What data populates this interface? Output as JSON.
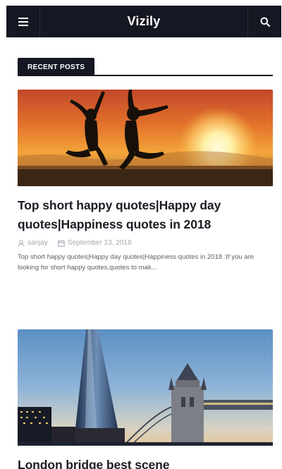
{
  "header": {
    "brand": "Vizily",
    "menu_icon": "hamburger-menu-icon",
    "search_icon": "search-icon"
  },
  "section": {
    "title": "RECENT POSTS"
  },
  "posts": [
    {
      "title": "Top short happy quotes|Happy day quotes|Happiness quotes in 2018",
      "author": "sanjay",
      "date": "September 13, 2018",
      "excerpt": "Top short happy quotes|Happy day quotes|Happiness quotes in 2018 :If you are looking for short happy quotes,quotes to mak...",
      "image": "silhouettes-jumping-sunset-beach"
    },
    {
      "title": "London bridge best scene",
      "image": "the-shard-and-tower-bridge-london"
    }
  ],
  "colors": {
    "header_bg": "#151722",
    "text": "#1b1c24",
    "meta": "#a3a6ae"
  }
}
